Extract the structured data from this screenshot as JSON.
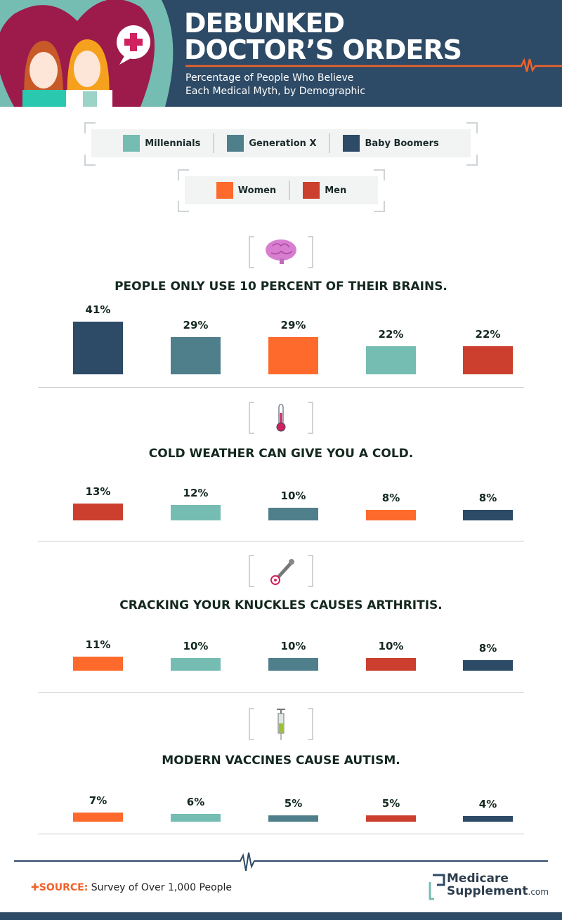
{
  "header": {
    "title_line1": "DEBUNKED",
    "title_line2": "DOCTOR’S ORDERS",
    "subtitle_line1": "Percentage of People Who Believe",
    "subtitle_line2": "Each Medical Myth, by Demographic"
  },
  "legend": {
    "generations": [
      {
        "label": "Millennials",
        "color": "#75bcb3"
      },
      {
        "label": "Generation X",
        "color": "#4e7f8a"
      },
      {
        "label": "Baby Boomers",
        "color": "#2d4a66"
      }
    ],
    "genders": [
      {
        "label": "Women",
        "color": "#fd6a2c"
      },
      {
        "label": "Men",
        "color": "#cc3f2e"
      }
    ]
  },
  "chart_data": [
    {
      "type": "bar",
      "title": "PEOPLE ONLY USE 10 PERCENT OF THEIR BRAINS.",
      "icon": "brain-icon",
      "categories": [
        "Baby Boomers",
        "Generation X",
        "Women",
        "Millennials",
        "Men"
      ],
      "values": [
        41,
        29,
        29,
        22,
        22
      ],
      "labels": [
        "41%",
        "29%",
        "29%",
        "22%",
        "22%"
      ]
    },
    {
      "type": "bar",
      "title": "COLD WEATHER CAN GIVE YOU A COLD.",
      "icon": "thermometer-icon",
      "categories": [
        "Men",
        "Millennials",
        "Generation X",
        "Women",
        "Baby Boomers"
      ],
      "values": [
        13,
        12,
        10,
        8,
        8
      ],
      "labels": [
        "13%",
        "12%",
        "10%",
        "8%",
        "8%"
      ]
    },
    {
      "type": "bar",
      "title": "CRACKING YOUR KNUCKLES CAUSES ARTHRITIS.",
      "icon": "bone-icon",
      "categories": [
        "Women",
        "Millennials",
        "Generation X",
        "Men",
        "Baby Boomers"
      ],
      "values": [
        11,
        10,
        10,
        10,
        8
      ],
      "labels": [
        "11%",
        "10%",
        "10%",
        "10%",
        "8%"
      ]
    },
    {
      "type": "bar",
      "title": "MODERN VACCINES CAUSE AUTISM.",
      "icon": "syringe-icon",
      "categories": [
        "Women",
        "Millennials",
        "Generation X",
        "Men",
        "Baby Boomers"
      ],
      "values": [
        7,
        6,
        5,
        5,
        4
      ],
      "labels": [
        "7%",
        "6%",
        "5%",
        "5%",
        "4%"
      ]
    }
  ],
  "footer": {
    "source_label": "SOURCE:",
    "source_text": "Survey of Over 1,000 People",
    "logo_line1": "Medicare",
    "logo_line2": "Supplement",
    "logo_suffix": ".com"
  }
}
